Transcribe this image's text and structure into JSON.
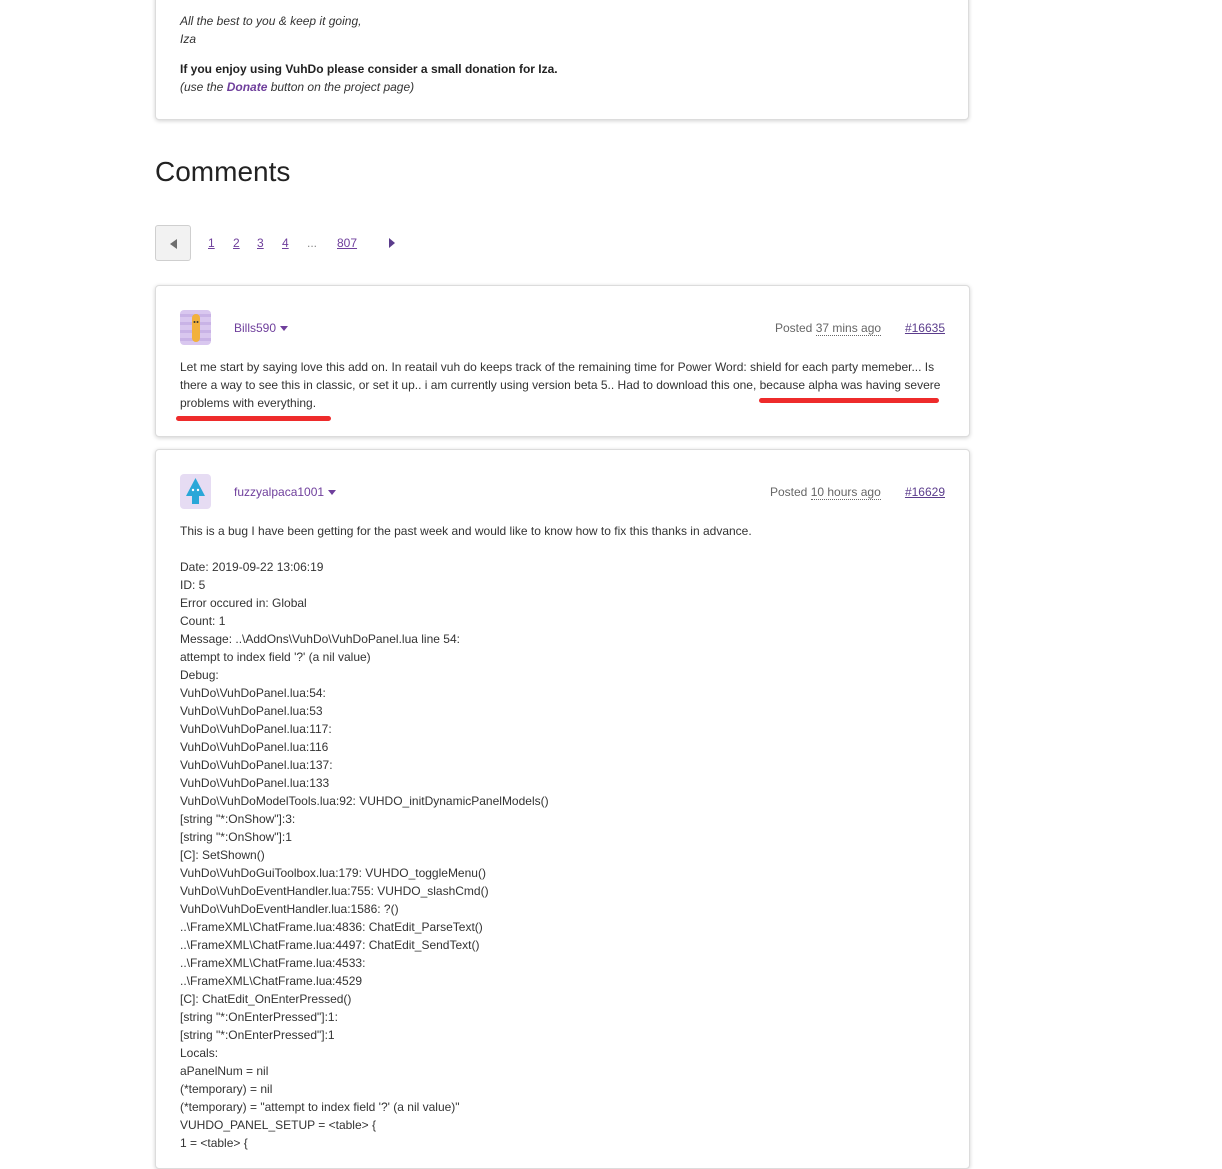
{
  "description": {
    "closing": "All the best to you & keep it going,",
    "signature": "Iza",
    "donation_heading": "If you enjoy using VuhDo please consider a small donation for Iza.",
    "donation_prefix": "(use the ",
    "donation_link": "Donate",
    "donation_suffix": " button on the project page)"
  },
  "comments_heading": "Comments",
  "pagination": {
    "pages": [
      "1",
      "2",
      "3",
      "4"
    ],
    "ellipsis": "...",
    "last": "807"
  },
  "comments": [
    {
      "username": "Bills590",
      "posted_label": "Posted",
      "posted_time": "37 mins ago",
      "number": "#16635",
      "body": "Let me start by saying love this add on. In reatail vuh do keeps track of the remaining time for Power Word: shield for each party memeber... Is there a way to see this in classic, or set it up.. i am currently using version beta 5.. Had to download this one, because alpha was having severe problems with everything."
    },
    {
      "username": "fuzzyalpaca1001",
      "posted_label": "Posted",
      "posted_time": "10 hours ago",
      "number": "#16629",
      "intro": "This is a bug I have been getting for the past week and would like to know how to fix this thanks in advance.",
      "log": "Date: 2019-09-22 13:06:19\nID: 5\nError occured in: Global\nCount: 1\nMessage: ..\\AddOns\\VuhDo\\VuhDoPanel.lua line 54:\nattempt to index field '?' (a nil value)\nDebug:\nVuhDo\\VuhDoPanel.lua:54:\nVuhDo\\VuhDoPanel.lua:53\nVuhDo\\VuhDoPanel.lua:117:\nVuhDo\\VuhDoPanel.lua:116\nVuhDo\\VuhDoPanel.lua:137:\nVuhDo\\VuhDoPanel.lua:133\nVuhDo\\VuhDoModelTools.lua:92: VUHDO_initDynamicPanelModels()\n[string \"*:OnShow\"]:3:\n[string \"*:OnShow\"]:1\n[C]: SetShown()\nVuhDo\\VuhDoGuiToolbox.lua:179: VUHDO_toggleMenu()\nVuhDo\\VuhDoEventHandler.lua:755: VUHDO_slashCmd()\nVuhDo\\VuhDoEventHandler.lua:1586: ?()\n..\\FrameXML\\ChatFrame.lua:4836: ChatEdit_ParseText()\n..\\FrameXML\\ChatFrame.lua:4497: ChatEdit_SendText()\n..\\FrameXML\\ChatFrame.lua:4533:\n..\\FrameXML\\ChatFrame.lua:4529\n[C]: ChatEdit_OnEnterPressed()\n[string \"*:OnEnterPressed\"]:1:\n[string \"*:OnEnterPressed\"]:1\nLocals:\naPanelNum = nil\n(*temporary) = nil\n(*temporary) = \"attempt to index field '?' (a nil value)\"\nVUHDO_PANEL_SETUP = <table> {\n1 = <table> {"
    }
  ],
  "colors": {
    "link_purple": "#6f3f9c",
    "annotation_red": "#ee2b2b"
  }
}
